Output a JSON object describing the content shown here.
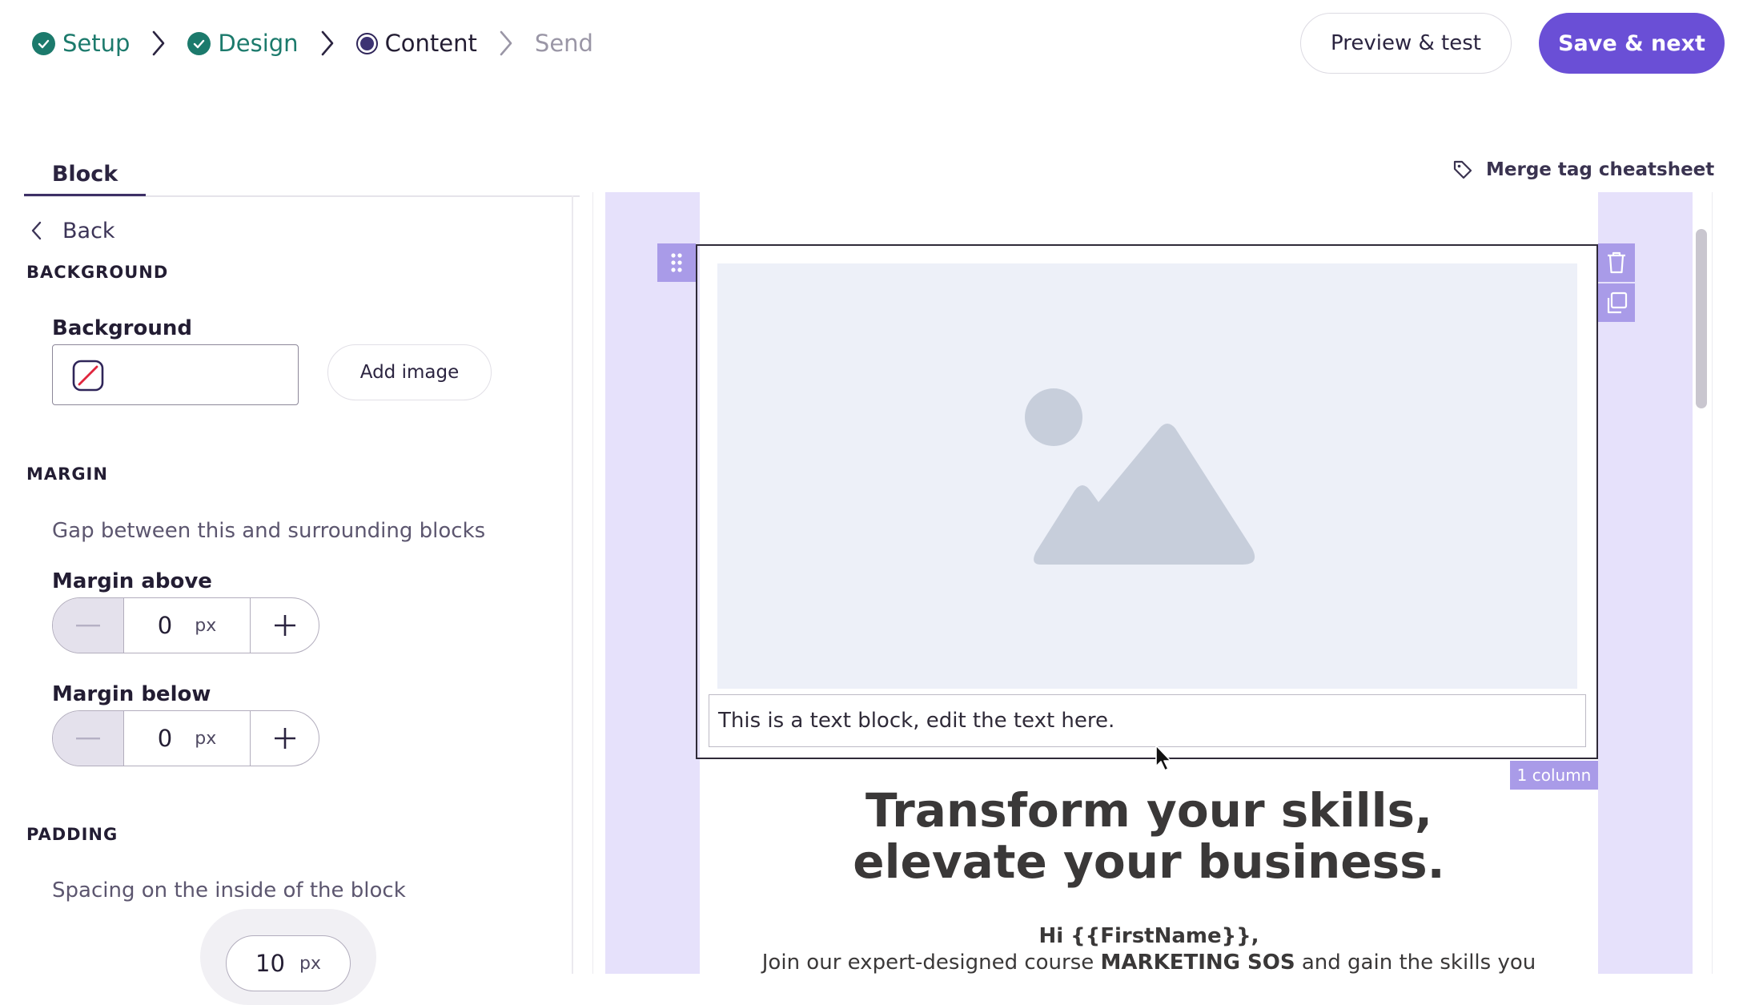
{
  "steps": [
    {
      "label": "Setup",
      "state": "done"
    },
    {
      "label": "Design",
      "state": "done"
    },
    {
      "label": "Content",
      "state": "current"
    },
    {
      "label": "Send",
      "state": "pending"
    }
  ],
  "header": {
    "preview_label": "Preview & test",
    "save_label": "Save & next"
  },
  "panel": {
    "tab_label": "Block",
    "back_label": "Back",
    "background": {
      "section_title": "BACKGROUND",
      "field_label": "Background",
      "add_image_label": "Add image"
    },
    "margin": {
      "section_title": "MARGIN",
      "hint": "Gap between this and surrounding blocks",
      "above_label": "Margin above",
      "above_value": "0",
      "below_label": "Margin below",
      "below_value": "0",
      "unit": "px"
    },
    "padding": {
      "section_title": "PADDING",
      "hint": "Spacing on the inside of the block",
      "value": "10",
      "unit": "px"
    }
  },
  "canvas": {
    "merge_tag_label": "Merge tag cheatsheet",
    "text_block": "This is a text block, edit the text here.",
    "column_badge": "1 column",
    "headline_line1": "Transform your skills,",
    "headline_line2": "elevate your business.",
    "greeting": "Hi {{FirstName}},",
    "body_pre": "Join our expert-designed course ",
    "body_bold": "MARKETING SOS",
    "body_post": " and gain the skills you"
  },
  "colors": {
    "accent": "#6a4fd6",
    "done": "#1c7a6c",
    "canvas_bg": "#e6e1fb",
    "selection_tools": "#a99be8"
  }
}
